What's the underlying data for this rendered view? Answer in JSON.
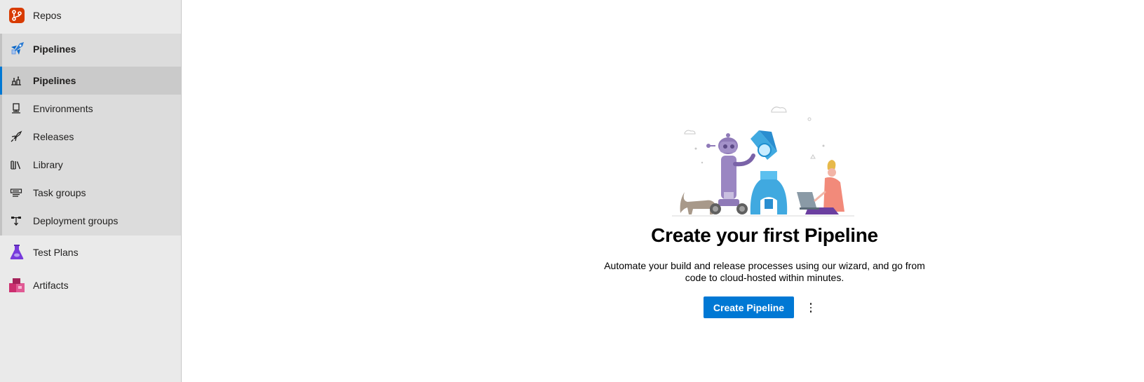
{
  "sidebar": {
    "top": [
      {
        "label": "Repos",
        "icon": "repos-icon",
        "color": "#d83b01"
      }
    ],
    "section": {
      "label": "Pipelines",
      "icon": "pipelines-icon"
    },
    "sub_items": [
      {
        "label": "Pipelines",
        "icon": "pipeline-rocket-icon",
        "selected": true
      },
      {
        "label": "Environments",
        "icon": "environments-icon"
      },
      {
        "label": "Releases",
        "icon": "releases-rocket-icon"
      },
      {
        "label": "Library",
        "icon": "library-icon"
      },
      {
        "label": "Task groups",
        "icon": "task-groups-icon"
      },
      {
        "label": "Deployment groups",
        "icon": "deployment-groups-icon"
      }
    ],
    "bottom": [
      {
        "label": "Test Plans",
        "icon": "test-plans-icon",
        "color": "#773adc"
      },
      {
        "label": "Artifacts",
        "icon": "artifacts-icon",
        "color": "#cc2f6f"
      }
    ]
  },
  "main": {
    "title": "Create your first Pipeline",
    "description": "Automate your build and release processes using our wizard, and go from code to cloud-hosted within minutes.",
    "primary_button": "Create Pipeline",
    "more_button": "more-options-icon"
  },
  "colors": {
    "accent": "#0078d4",
    "sidebar_bg": "#eaeaea",
    "group_bg": "#dcdcdc",
    "selected_bg": "#cacaca"
  }
}
